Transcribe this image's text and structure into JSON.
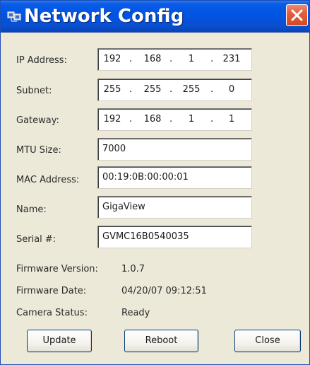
{
  "window": {
    "title": "Network Config",
    "icon": "network-config-app-icon"
  },
  "form": {
    "ip_address": {
      "label": "IP Address:",
      "octets": [
        "192",
        "168",
        "1",
        "231"
      ]
    },
    "subnet": {
      "label": "Subnet:",
      "octets": [
        "255",
        "255",
        "255",
        "0"
      ]
    },
    "gateway": {
      "label": "Gateway:",
      "octets": [
        "192",
        "168",
        "1",
        "1"
      ]
    },
    "mtu_size": {
      "label": "MTU Size:",
      "value": "7000"
    },
    "mac_address": {
      "label": "MAC Address:",
      "value": "00:19:0B:00:00:01"
    },
    "name": {
      "label": "Name:",
      "value": "GigaView"
    },
    "serial": {
      "label": "Serial #:",
      "value": "GVMC16B0540035"
    }
  },
  "info": {
    "firmware_version": {
      "label": "Firmware Version:",
      "value": "1.0.7"
    },
    "firmware_date": {
      "label": "Firmware Date:",
      "value": "04/20/07 09:12:51"
    },
    "camera_status": {
      "label": "Camera Status:",
      "value": "Ready"
    }
  },
  "buttons": {
    "update": "Update",
    "reboot": "Reboot",
    "close": "Close"
  },
  "colors": {
    "titlebar": "#0054e3",
    "close_button": "#e35f3c",
    "window_bg": "#ece9d8"
  }
}
